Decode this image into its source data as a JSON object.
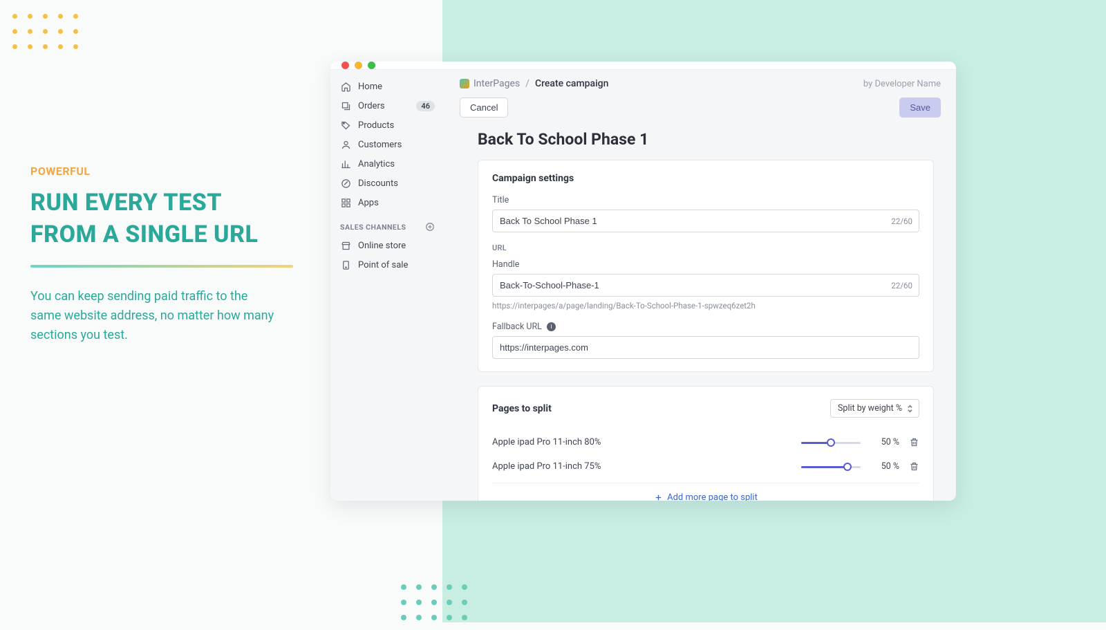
{
  "marketing": {
    "eyebrow": "POWERFUL",
    "headline": "RUN EVERY TEST FROM A SINGLE URL",
    "body": "You can keep sending paid traffic to the same website address, no matter how many sections you test."
  },
  "sidebar": {
    "items": [
      {
        "label": "Home"
      },
      {
        "label": "Orders",
        "badge": "46"
      },
      {
        "label": "Products"
      },
      {
        "label": "Customers"
      },
      {
        "label": "Analytics"
      },
      {
        "label": "Discounts"
      },
      {
        "label": "Apps"
      }
    ],
    "channels_header": "SALES CHANNELS",
    "channels": [
      {
        "label": "Online store"
      },
      {
        "label": "Point of sale"
      }
    ]
  },
  "header": {
    "brand": "InterPages",
    "breadcrumb_current": "Create campaign",
    "byline": "by Developer Name"
  },
  "actions": {
    "cancel": "Cancel",
    "save": "Save"
  },
  "page": {
    "title": "Back To School Phase 1"
  },
  "settings": {
    "card_title": "Campaign settings",
    "title_label": "Title",
    "title_value": "Back To School Phase 1",
    "title_counter": "22/60",
    "url_section": "URL",
    "handle_label": "Handle",
    "handle_value": "Back-To-School-Phase-1",
    "handle_counter": "22/60",
    "handle_hint": "https://interpages/a/page/landing/Back-To-School-Phase-1-spwzeq6zet2h",
    "fallback_label": "Fallback URL",
    "fallback_value": "https://interpages.com"
  },
  "split": {
    "card_title": "Pages to split",
    "mode": "Split by weight %",
    "rows": [
      {
        "name": "Apple ipad Pro 11-inch 80%",
        "pct": "50 %",
        "fill": 50
      },
      {
        "name": "Apple ipad Pro 11-inch 75%",
        "pct": "50 %",
        "fill": 78
      }
    ],
    "add": "Add more page to split"
  }
}
